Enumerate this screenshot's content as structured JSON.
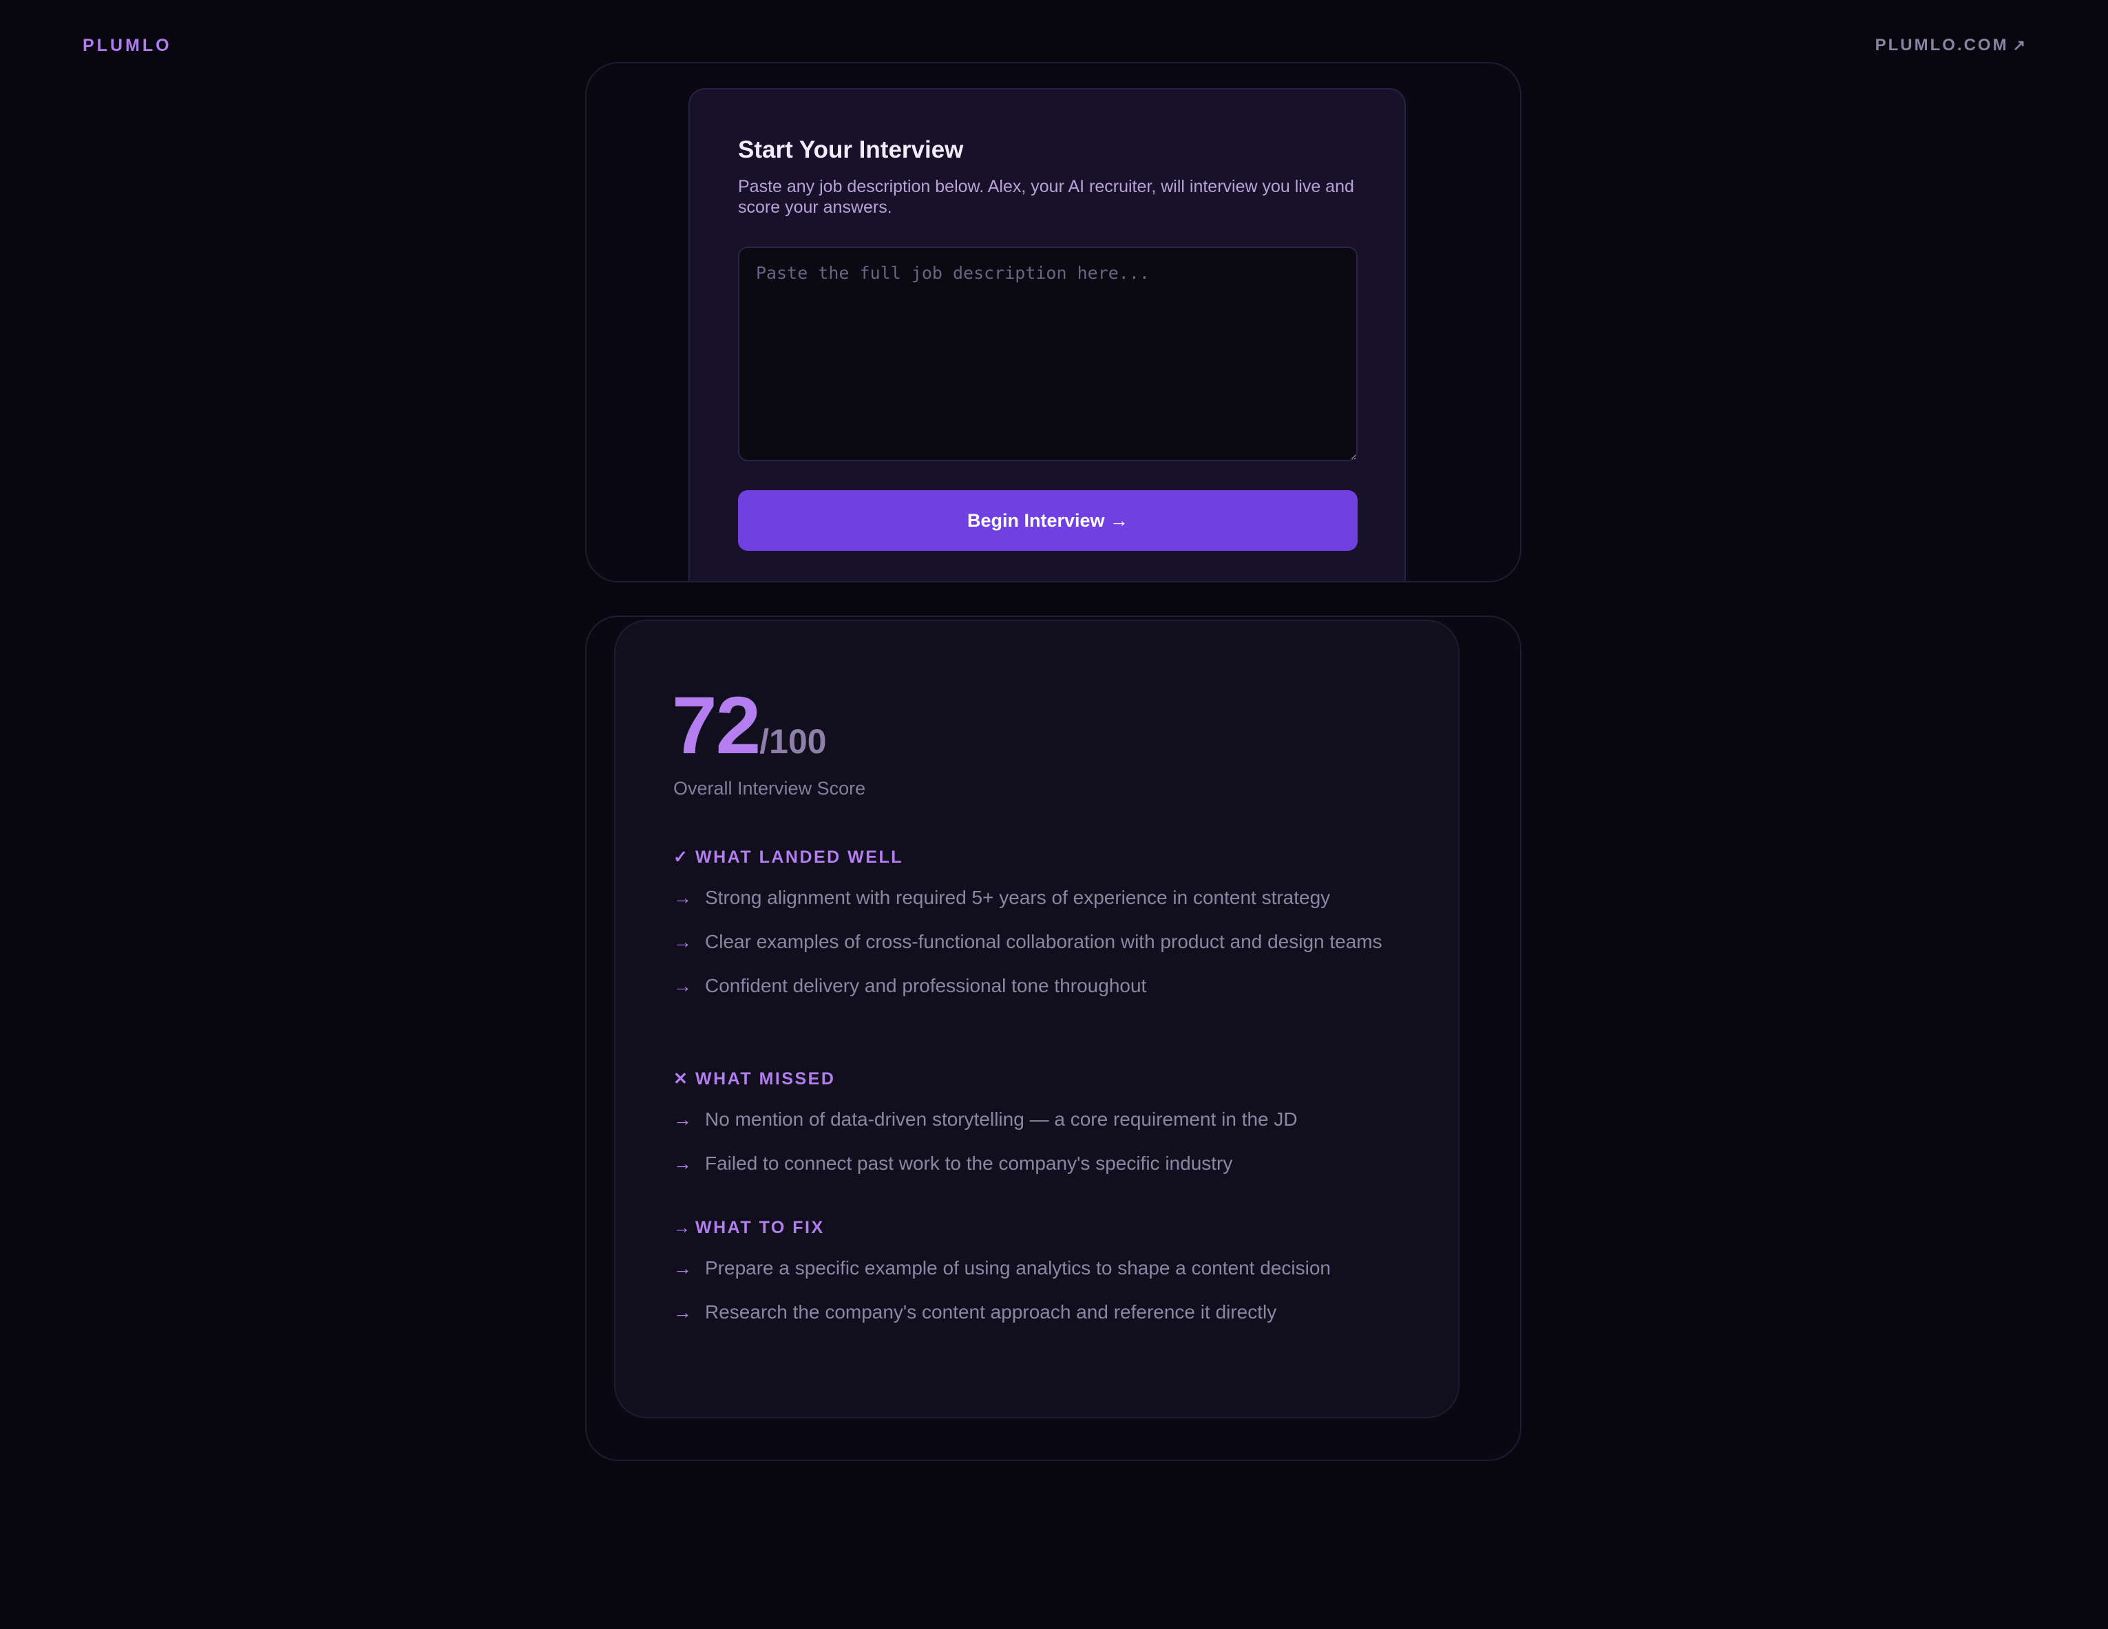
{
  "header": {
    "brand": "PLUMLO",
    "site_link": "PLUMLO.COM",
    "site_link_icon": "arrow-up-right-icon"
  },
  "interview_form": {
    "title": "Start Your Interview",
    "description": "Paste any job description below. Alex, your AI recruiter, will interview you live and score your answers.",
    "jd_value": "",
    "jd_placeholder": "Paste the full job description here...",
    "begin_label": "Begin Interview →"
  },
  "results": {
    "score": "72",
    "score_max": "/100",
    "score_label": "Overall Interview Score",
    "sections": [
      {
        "icon": "check-icon",
        "glyph": "✓",
        "title": "WHAT LANDED WELL",
        "items": [
          "Strong alignment with required 5+ years of experience in content strategy",
          "Clear examples of cross-functional collaboration with product and design teams",
          "Confident delivery and professional tone throughout"
        ]
      },
      {
        "icon": "x-icon",
        "glyph": "✕",
        "title": "WHAT MISSED",
        "items": [
          "No mention of data-driven storytelling — a core requirement in the JD",
          "Failed to connect past work to the company's specific industry"
        ]
      },
      {
        "icon": "arrow-right-icon",
        "glyph": "→",
        "title": "WHAT TO FIX",
        "items": [
          "Prepare a specific example of using analytics to shape a content decision",
          "Research the company's content approach and reference it directly"
        ]
      }
    ],
    "bullet_glyph": "→"
  },
  "colors": {
    "background": "#08070f",
    "accent": "#b47ef0",
    "button": "#7140e0",
    "form_card": "#18112a",
    "result_card": "#110f1d"
  }
}
